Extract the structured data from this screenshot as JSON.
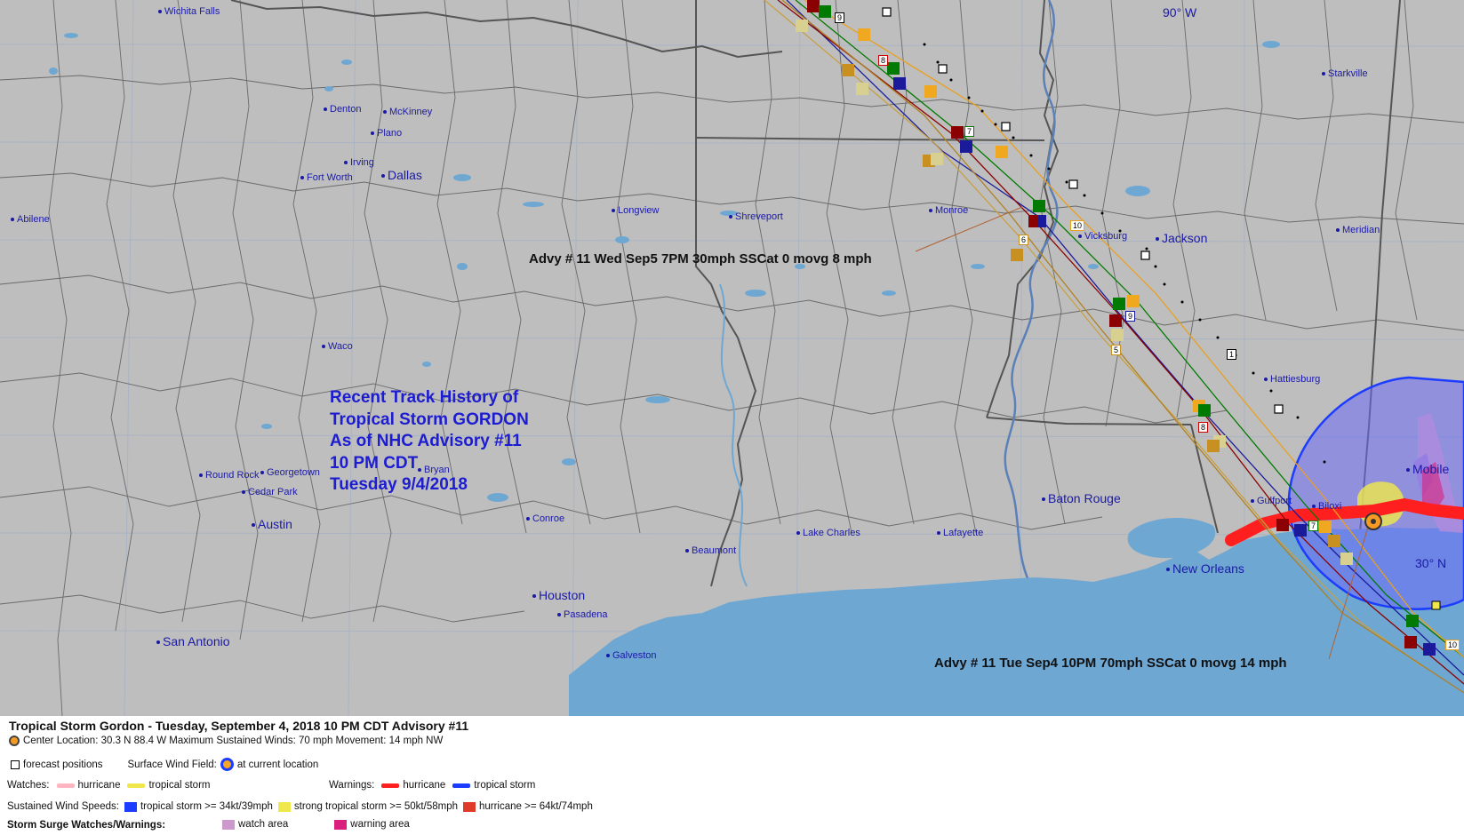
{
  "map": {
    "history_lines": [
      "Recent Track History of",
      "Tropical Storm GORDON",
      "As of NHC Advisory #11",
      "10 PM CDT",
      "Tuesday 9/4/2018"
    ],
    "advisory_labels": [
      "Advy # 11 Wed Sep5 7PM  30mph SSCat 0 movg 8 mph",
      "Advy # 11 Tue Sep4 10PM  70mph SSCat 0 movg 14 mph"
    ],
    "coord_labels": {
      "lon": "90° W",
      "lat": "30° N"
    },
    "cities": [
      "Wichita Falls",
      "Denton",
      "McKinney",
      "Plano",
      "Irving",
      "Fort Worth",
      "Dallas",
      "Abilene",
      "Longview",
      "Shreveport",
      "Monroe",
      "Vicksburg",
      "Jackson",
      "Meridian",
      "Starkville",
      "Waco",
      "Hattiesburg",
      "Mobile",
      "Gulfport",
      "Biloxi",
      "Round Rock",
      "Georgetown",
      "Bryan",
      "Cedar Park",
      "Austin",
      "Conroe",
      "Beaumont",
      "Lake Charles",
      "Lafayette",
      "Baton Rouge",
      "New Orleans",
      "Houston",
      "Pasadena",
      "San Antonio",
      "Galveston"
    ],
    "track_point_labels": [
      "9",
      "8",
      "7",
      "10",
      "6",
      "9",
      "5",
      "8",
      "7",
      "1",
      "10"
    ]
  },
  "legend": {
    "title": "Tropical Storm Gordon  -  Tuesday, September 4, 2018  10 PM CDT   Advisory #11",
    "center": "Center Location: 30.3 N  88.4 W   Maximum Sustained Winds: 70 mph  Movement: 14 mph NW",
    "forecast_positions": "forecast positions",
    "surface_wind_field": "Surface Wind Field:",
    "at_current_location": "at current location",
    "watches_label": "Watches:",
    "watch_hurricane": "hurricane",
    "watch_tropical_storm": "tropical storm",
    "warnings_label": "Warnings:",
    "warning_hurricane": "hurricane",
    "warning_tropical_storm": "tropical storm",
    "sustained_label": "Sustained Wind Speeds:",
    "ts": "tropical storm >= 34kt/39mph",
    "sts": "strong tropical storm >= 50kt/58mph",
    "hu": "hurricane >= 64kt/74mph",
    "surge_label": "Storm Surge Watches/Warnings:",
    "watch_area": "watch area",
    "warning_area": "warning area"
  },
  "colors": {
    "land": "#bebebe",
    "water": "#6fa7d3",
    "ts_wind": "#1c3cff",
    "sts_wind": "#f0e84a",
    "hurricane_warning": "#ff1f1f",
    "hurricane_watch": "#ffb6c1",
    "surge_watch": "#cc99cc",
    "surge_warning": "#d8207c"
  }
}
